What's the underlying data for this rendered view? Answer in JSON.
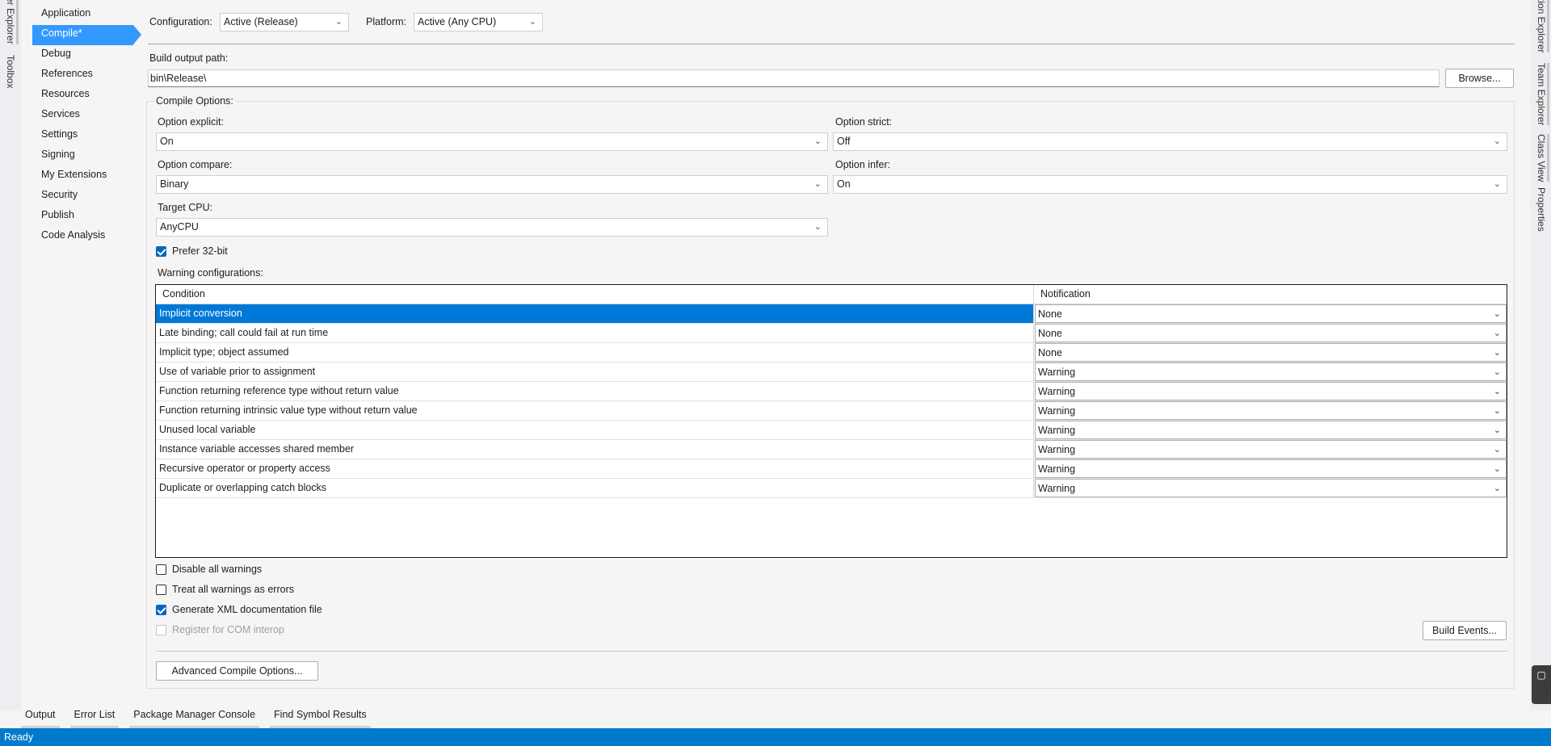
{
  "left_rail": {
    "tabs": [
      "er Explorer",
      "Toolbox"
    ]
  },
  "right_rail": {
    "tabs": [
      "tion Explorer",
      "Team Explorer",
      "Class View",
      "Properties"
    ]
  },
  "nav": {
    "items": [
      {
        "label": "Application"
      },
      {
        "label": "Compile*"
      },
      {
        "label": "Debug"
      },
      {
        "label": "References"
      },
      {
        "label": "Resources"
      },
      {
        "label": "Services"
      },
      {
        "label": "Settings"
      },
      {
        "label": "Signing"
      },
      {
        "label": "My Extensions"
      },
      {
        "label": "Security"
      },
      {
        "label": "Publish"
      },
      {
        "label": "Code Analysis"
      }
    ],
    "selected": "Compile*"
  },
  "config": {
    "configuration_label": "Configuration:",
    "configuration_value": "Active (Release)",
    "platform_label": "Platform:",
    "platform_value": "Active (Any CPU)"
  },
  "build_output": {
    "label": "Build output path:",
    "value": "bin\\Release\\",
    "browse_label": "Browse..."
  },
  "compile_options": {
    "title": "Compile Options:",
    "option_explicit_label": "Option explicit:",
    "option_explicit_value": "On",
    "option_strict_label": "Option strict:",
    "option_strict_value": "Off",
    "option_compare_label": "Option compare:",
    "option_compare_value": "Binary",
    "option_infer_label": "Option infer:",
    "option_infer_value": "On",
    "target_cpu_label": "Target CPU:",
    "target_cpu_value": "AnyCPU",
    "prefer32_label": "Prefer 32-bit",
    "prefer32_checked": true
  },
  "warnings": {
    "title": "Warning configurations:",
    "headers": {
      "condition": "Condition",
      "notification": "Notification"
    },
    "rows": [
      {
        "condition": "Implicit conversion",
        "notification": "None"
      },
      {
        "condition": "Late binding; call could fail at run time",
        "notification": "None"
      },
      {
        "condition": "Implicit type; object assumed",
        "notification": "None"
      },
      {
        "condition": "Use of variable prior to assignment",
        "notification": "Warning"
      },
      {
        "condition": "Function returning reference type without return value",
        "notification": "Warning"
      },
      {
        "condition": "Function returning intrinsic value type without return value",
        "notification": "Warning"
      },
      {
        "condition": "Unused local variable",
        "notification": "Warning"
      },
      {
        "condition": "Instance variable accesses shared member",
        "notification": "Warning"
      },
      {
        "condition": "Recursive operator or property access",
        "notification": "Warning"
      },
      {
        "condition": "Duplicate or overlapping catch blocks",
        "notification": "Warning"
      }
    ],
    "selected_row": 0
  },
  "checkboxes": {
    "disable_all": {
      "label": "Disable all warnings",
      "checked": false
    },
    "treat_as_errors": {
      "label": "Treat all warnings as errors",
      "checked": false
    },
    "gen_xml": {
      "label": "Generate XML documentation file",
      "checked": true
    },
    "com_interop": {
      "label": "Register for COM interop",
      "checked": false,
      "disabled": true
    }
  },
  "buttons": {
    "build_events": "Build Events...",
    "advanced": "Advanced Compile Options..."
  },
  "tool_tabs": [
    "Output",
    "Error List",
    "Package Manager Console",
    "Find Symbol Results"
  ],
  "status": {
    "text": "Ready"
  },
  "colors": {
    "accent": "#007acc",
    "nav_selected": "#3399ff",
    "row_selected": "#0078d7"
  }
}
